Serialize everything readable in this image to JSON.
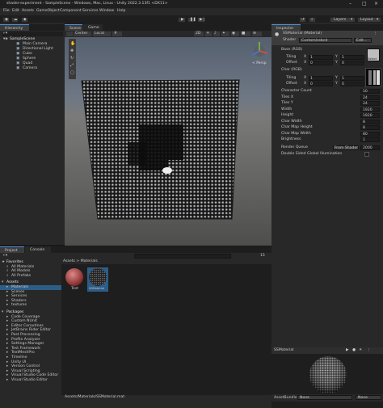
{
  "window": {
    "title": "shader-experiment - SampleScene - Windows, Mac, Linux - Unity 2022.3.13f1 <DX11>"
  },
  "menu": [
    "File",
    "Edit",
    "Assets",
    "GameObject",
    "Component",
    "Services",
    "Window",
    "Help"
  ],
  "toolbar": {
    "layers": "Layers",
    "layout": "Layout"
  },
  "hierarchy": {
    "tab": "Hierarchy",
    "scene": "SampleScene",
    "items": [
      "Main Camera",
      "Directional Light",
      "Cube",
      "Sphere",
      "Quad",
      "Camera"
    ]
  },
  "scene": {
    "tab_scene": "Scene",
    "tab_game": "Game",
    "shading": "Center",
    "space": "Local",
    "mode": "2D",
    "persp": "< Persp"
  },
  "inspector": {
    "tab": "Inspector",
    "material": "SSMaterial (Material)",
    "shader_label": "Shader",
    "shader_value": "Custom/ssbcd",
    "edit": "Edit...",
    "base_label": "Base (RGB)",
    "tiling": "Tiling",
    "offset": "Offset",
    "select": "Select",
    "char_label": "Char (RGB)",
    "props": [
      {
        "label": "Character Count",
        "value": "10"
      },
      {
        "label": "Tiles X",
        "value": "24"
      },
      {
        "label": "Tiles Y",
        "value": "24"
      },
      {
        "label": "Width",
        "value": "1920"
      },
      {
        "label": "Height",
        "value": "1920"
      },
      {
        "label": "Char Width",
        "value": "8"
      },
      {
        "label": "Char Map Height",
        "value": "8"
      },
      {
        "label": "Char Map Width",
        "value": "80"
      },
      {
        "label": "Brightness",
        "value": "1"
      }
    ],
    "render_queue_label": "Render Queue",
    "render_queue_mode": "From Shader",
    "render_queue_value": "2000",
    "double_sided": "Double Sided Global Illumination",
    "base_x": "1",
    "base_y": "1",
    "base_ox": "0",
    "base_oy": "0",
    "char_x": "1",
    "char_y": "1",
    "char_ox": "0",
    "char_oy": "0"
  },
  "preview": {
    "title": "SSMaterial",
    "assetbundle": "AssetBundle",
    "none1": "None",
    "none2": "None"
  },
  "project": {
    "tab_project": "Project",
    "tab_console": "Console",
    "count": "15",
    "favorites": "Favorites",
    "fav_items": [
      "All Materials",
      "All Models",
      "All Prefabs"
    ],
    "assets": "Assets",
    "asset_folders": [
      "Materials",
      "Scenes",
      "Services",
      "Shaders",
      "textures"
    ],
    "packages": "Packages",
    "package_items": [
      "Code Coverage",
      "Custom NUnit",
      "Editor Coroutines",
      "JetBrains Rider Editor",
      "Post Processing",
      "Profile Analyzer",
      "Settings Manager",
      "Test Framework",
      "TextMeshPro",
      "Timeline",
      "Unity UI",
      "Version Control",
      "Visual Scripting",
      "Visual Studio Code Editor",
      "Visual Studio Editor"
    ],
    "breadcrumb": "Assets > Materials",
    "thumbs": [
      "Test",
      "SSMaterial"
    ],
    "status_path": "Assets/Materials/SSMaterial.mat"
  }
}
